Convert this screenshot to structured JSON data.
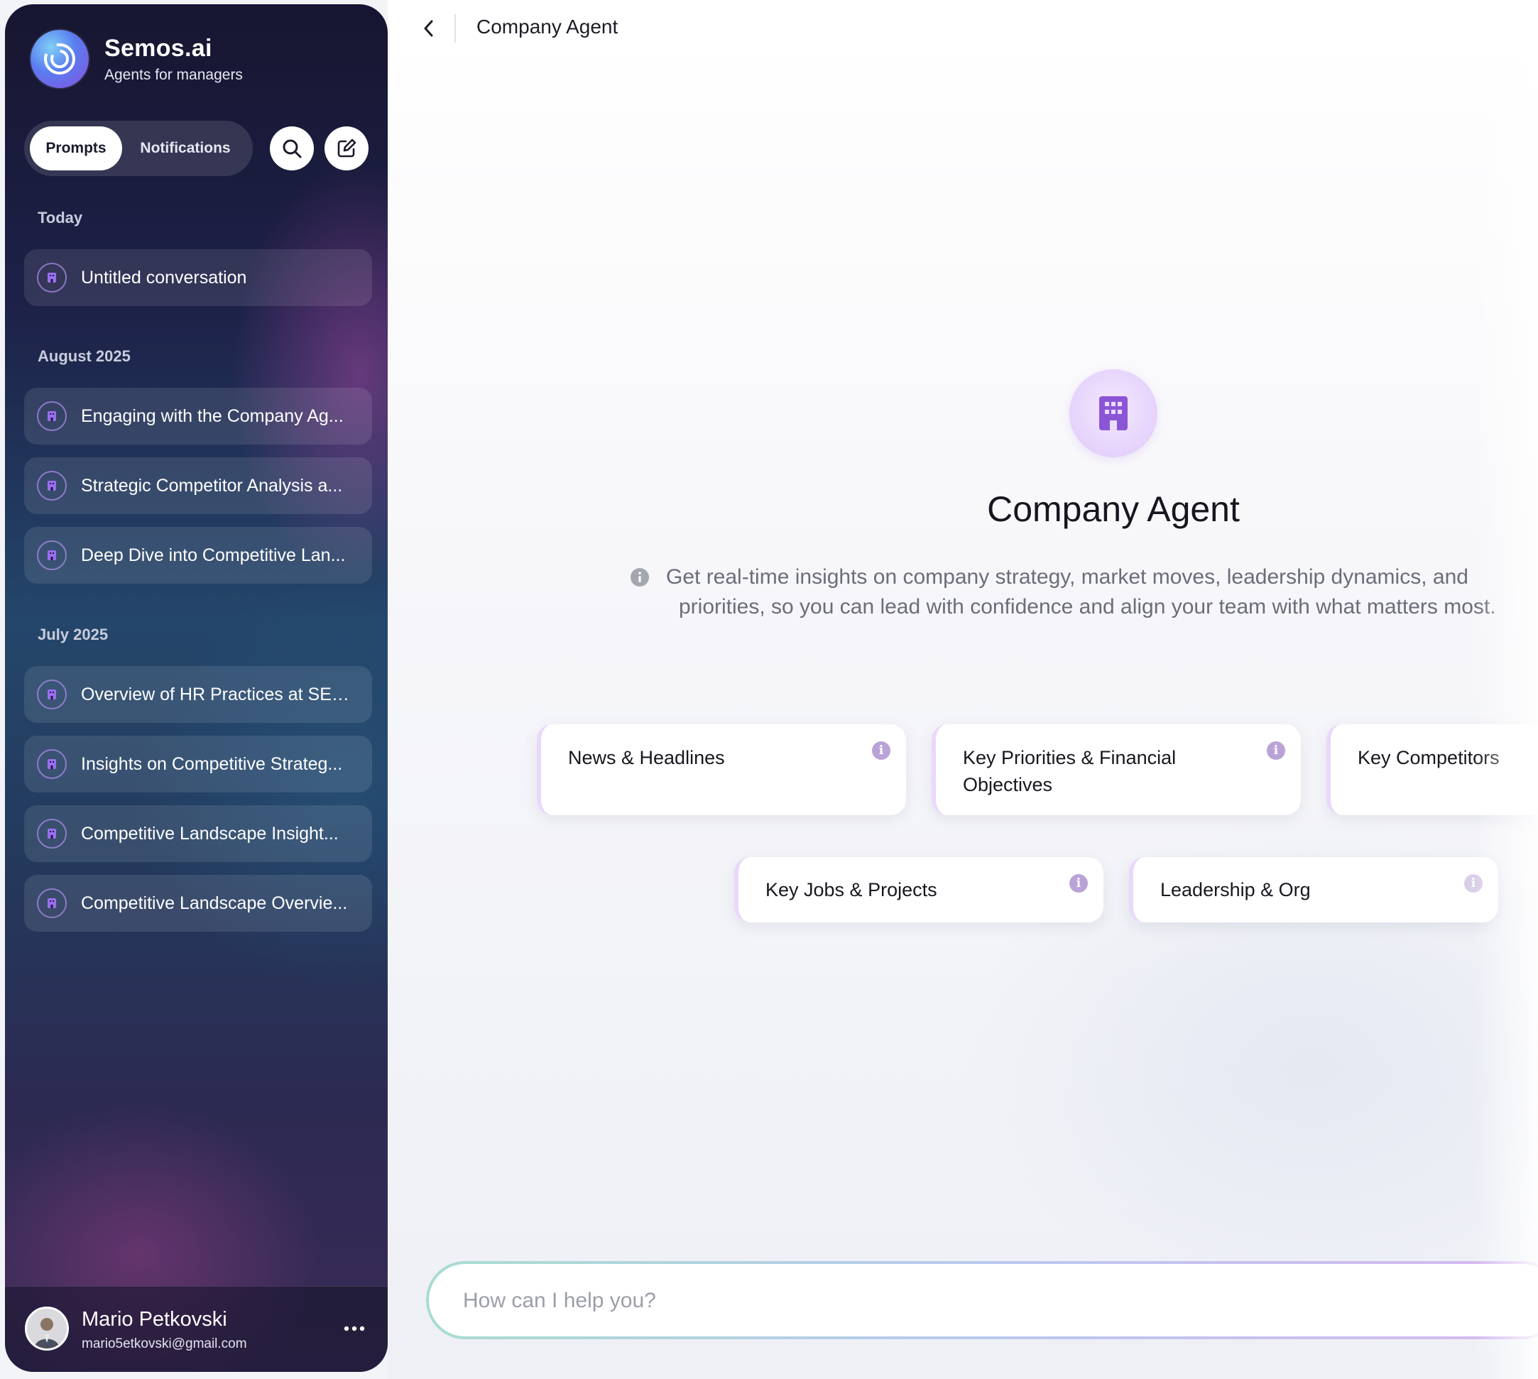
{
  "sidebar": {
    "brand": {
      "name": "Semos.ai",
      "tagline": "Agents for managers"
    },
    "tabs": {
      "prompts": "Prompts",
      "notifications": "Notifications"
    },
    "sections": [
      {
        "label": "Today",
        "items": [
          "Untitled conversation"
        ]
      },
      {
        "label": "August 2025",
        "items": [
          "Engaging with the Company Ag...",
          "Strategic Competitor Analysis a...",
          "Deep Dive into Competitive Lan..."
        ]
      },
      {
        "label": "July 2025",
        "items": [
          "Overview of HR Practices at SEM...",
          "Insights on Competitive Strateg...",
          "Competitive Landscape Insight...",
          "Competitive Landscape Overvie..."
        ]
      }
    ],
    "user": {
      "name": "Mario Petkovski",
      "email": "mario5etkovski@gmail.com"
    }
  },
  "header": {
    "title": "Company Agent"
  },
  "agent": {
    "title": "Company Agent",
    "description_line1": "Get real-time insights on company strategy, market moves, leadership dynamics, and",
    "description_line2": "priorities, so you can lead with confidence and align your team with what matters most."
  },
  "cards": [
    "News & Headlines",
    "Key Priorities & Financial Objectives",
    "Key Competitors",
    "Key Jobs & Projects",
    "Leadership & Org"
  ],
  "chat": {
    "placeholder": "How can I help you?"
  },
  "colors": {
    "accent": "#8b55d6",
    "sidebar_dark": "#1b1c3a"
  },
  "icons": [
    "semos-logo-icon",
    "search-icon",
    "edit-icon",
    "conversation-icon",
    "back-icon",
    "building-icon",
    "info-icon",
    "more-icon"
  ]
}
